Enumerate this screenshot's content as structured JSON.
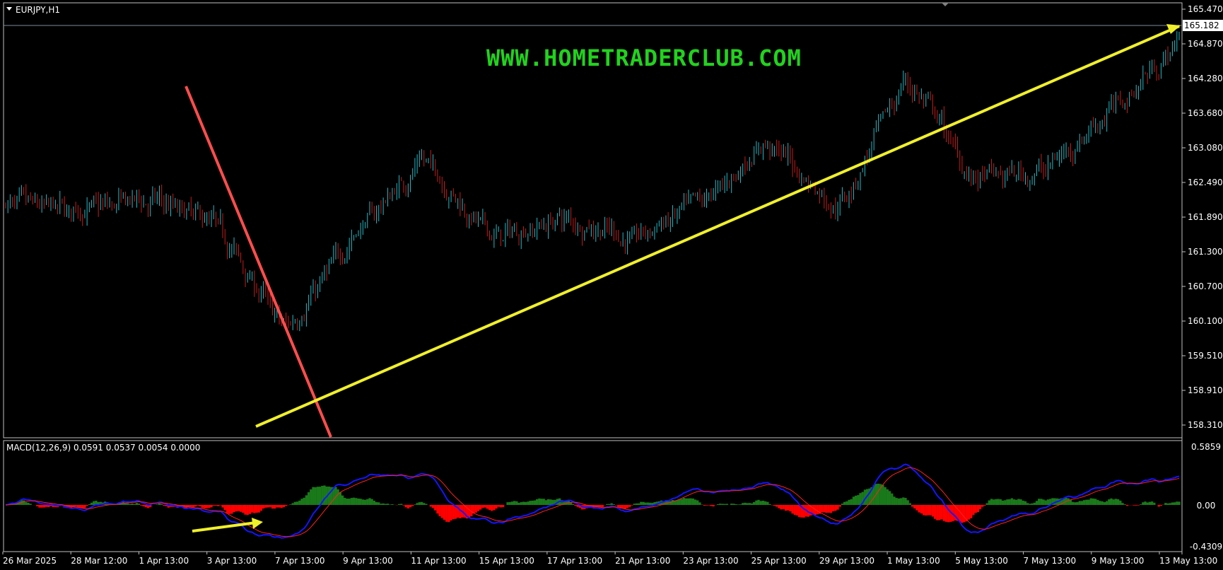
{
  "symbol_label": "EURJPY,H1",
  "watermark": "WWW.HOMETRADERCLUB.COM",
  "price_axis": {
    "ticks": [
      "165.470",
      "164.870",
      "164.280",
      "163.680",
      "163.080",
      "162.490",
      "161.890",
      "161.300",
      "160.700",
      "160.100",
      "159.510",
      "158.910",
      "158.310"
    ],
    "current": "165.182"
  },
  "macd": {
    "label": "MACD(12,26,9) 0.0591 0.0537 0.0054 0.0000",
    "ticks": [
      "0.5859",
      "0.00",
      "-0.4309"
    ]
  },
  "time_axis": [
    "26 Mar 2025",
    "28 Mar 12:00",
    "1 Apr 13:00",
    "3 Apr 13:00",
    "7 Apr 13:00",
    "9 Apr 13:00",
    "11 Apr 13:00",
    "15 Apr 13:00",
    "17 Apr 13:00",
    "21 Apr 13:00",
    "23 Apr 13:00",
    "25 Apr 13:00",
    "29 Apr 13:00",
    "1 May 13:00",
    "5 May 13:00",
    "7 May 13:00",
    "9 May 13:00",
    "13 May 13:00"
  ],
  "colors": {
    "background": "#000000",
    "frame": "#c0c0c0",
    "bull_candle": "#26b8c4",
    "bear_candle": "#c41e1e",
    "trendline_up": "#f0f02a",
    "trendline_down": "#ff4d4d",
    "macd_hist_pos": "#1a7a1a",
    "macd_hist_neg": "#ff0000",
    "macd_line": "#1515ff",
    "signal_line": "#ff2020",
    "watermark": "#22d21e"
  },
  "chart_data": {
    "type": "line",
    "title": "EURJPY,H1",
    "series": [
      {
        "name": "EURJPY,H1",
        "x": [
          "26 Mar 2025",
          "28 Mar 12:00",
          "1 Apr 13:00",
          "3 Apr 13:00",
          "7 Apr 13:00",
          "9 Apr 13:00",
          "11 Apr 13:00",
          "15 Apr 13:00",
          "17 Apr 13:00",
          "21 Apr 13:00",
          "23 Apr 13:00",
          "25 Apr 13:00",
          "29 Apr 13:00",
          "1 May 13:00",
          "5 May 13:00",
          "7 May 13:00",
          "9 May 13:00",
          "13 May 13:00"
        ],
        "values": [
          162.1,
          162.0,
          162.2,
          161.8,
          159.9,
          161.6,
          162.9,
          161.5,
          161.9,
          161.5,
          162.1,
          163.2,
          162.0,
          164.3,
          162.5,
          162.7,
          163.8,
          165.0
        ]
      }
    ],
    "ylim": [
      158.2,
      165.5
    ],
    "grid": false,
    "annotations": [
      "up trendline 158.31 → 165.18",
      "down trendline from 1 Apr high"
    ]
  }
}
